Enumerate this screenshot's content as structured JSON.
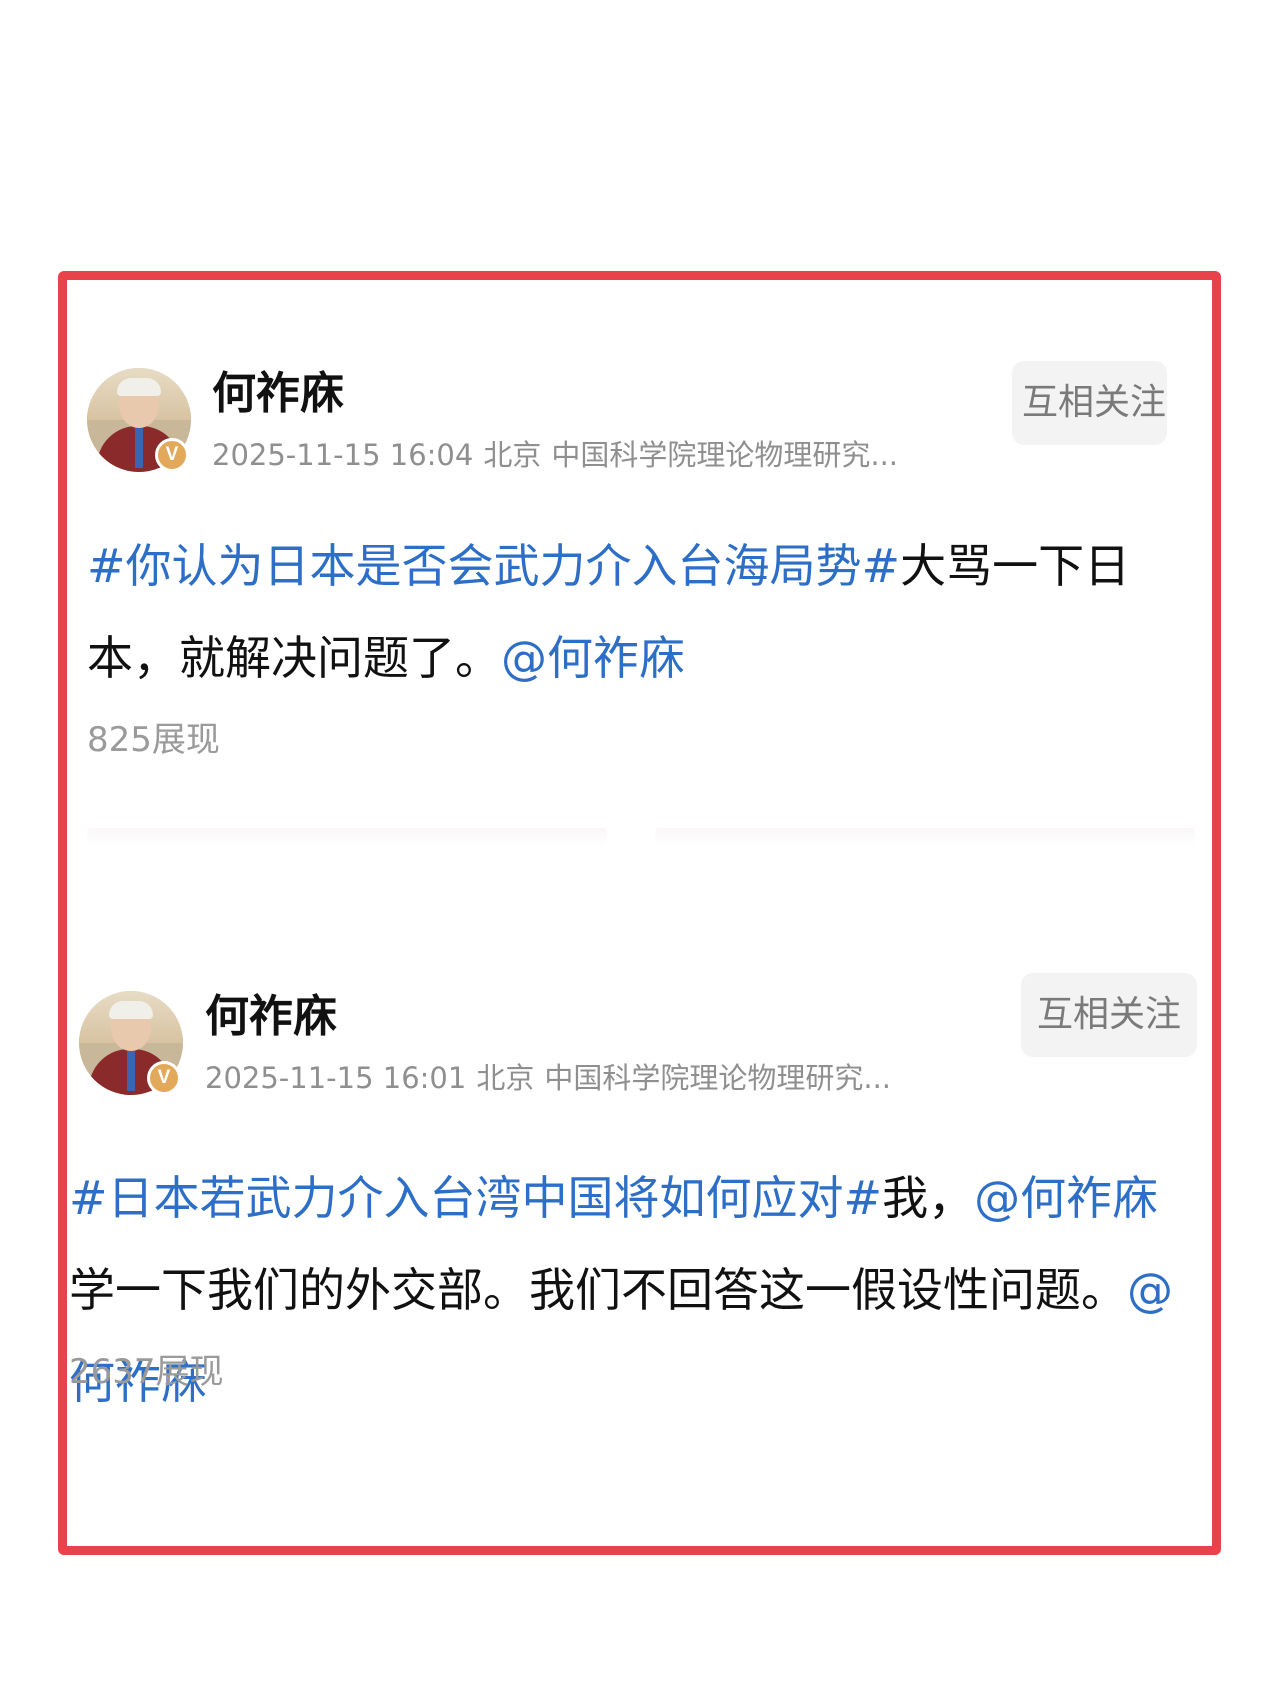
{
  "colors": {
    "frame": "#e8434b",
    "link": "#2d6fc7",
    "meta": "#8f8f8f",
    "badge": "#e3a95a"
  },
  "posts": [
    {
      "user": "何祚庥",
      "badge": "V",
      "meta": {
        "datetime": "2025-11-15 16:04",
        "location": "北京",
        "org": "中国科学院理论物理研究..."
      },
      "follow_label": "互相关注",
      "text_parts": [
        {
          "type": "hashtag",
          "text": "#你认为日本是否会武力介入台海局势#"
        },
        {
          "type": "plain",
          "text": "大骂一下日本，就解决问题了。"
        },
        {
          "type": "mention",
          "text": "@何祚庥"
        }
      ],
      "views": "825展现"
    },
    {
      "user": "何祚庥",
      "badge": "V",
      "meta": {
        "datetime": "2025-11-15 16:01",
        "location": "北京",
        "org": "中国科学院理论物理研究..."
      },
      "follow_label": "互相关注",
      "text_parts": [
        {
          "type": "hashtag",
          "text": "#日本若武力介入台湾中国将如何应对#"
        },
        {
          "type": "plain",
          "text": "我，"
        },
        {
          "type": "mention",
          "text": "@何祚庥"
        },
        {
          "type": "plain",
          "text": " 学一下我们的外交部。我们不回答这一假设性问题。"
        },
        {
          "type": "mention",
          "text": "@何祚庥"
        }
      ],
      "views": "2637展现"
    }
  ]
}
